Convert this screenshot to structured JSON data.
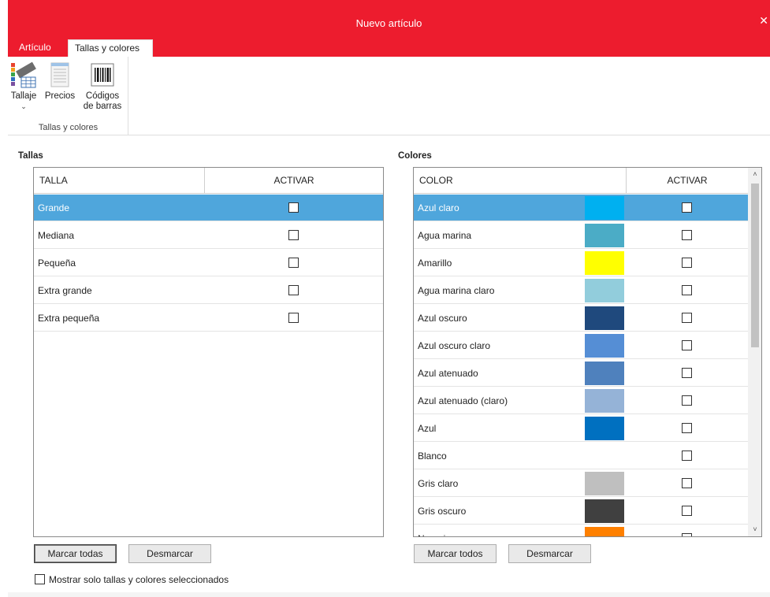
{
  "window": {
    "title": "Nuevo artículo",
    "close_glyph": "✕"
  },
  "tabs": [
    {
      "label": "Artículo",
      "active": false
    },
    {
      "label": "Tallas y colores",
      "active": true
    }
  ],
  "ribbon": {
    "group_label": "Tallas y colores",
    "buttons": [
      {
        "label": "Tallaje",
        "icon": "size-chart-icon",
        "has_dropdown": true,
        "caret": "⌄"
      },
      {
        "label": "Precios",
        "icon": "price-sheet-icon"
      },
      {
        "label_line1": "Códigos",
        "label_line2": "de barras",
        "icon": "barcode-icon"
      }
    ]
  },
  "tallas": {
    "section_label": "Tallas",
    "columns": [
      "TALLA",
      "ACTIVAR"
    ],
    "rows": [
      {
        "name": "Grande",
        "checked": false,
        "selected": true
      },
      {
        "name": "Mediana",
        "checked": false
      },
      {
        "name": "Pequeña",
        "checked": false
      },
      {
        "name": "Extra grande",
        "checked": false
      },
      {
        "name": "Extra pequeña",
        "checked": false
      }
    ],
    "mark_all_label": "Marcar todas",
    "unmark_label": "Desmarcar"
  },
  "colores": {
    "section_label": "Colores",
    "columns": [
      "COLOR",
      "ACTIVAR"
    ],
    "rows": [
      {
        "name": "Azul claro",
        "swatch": "#00b0f0",
        "checked": false,
        "selected": true
      },
      {
        "name": "Agua marina",
        "swatch": "#4bacc6",
        "checked": false
      },
      {
        "name": "Amarillo",
        "swatch": "#ffff00",
        "checked": false
      },
      {
        "name": "Agua marina claro",
        "swatch": "#92cddc",
        "checked": false
      },
      {
        "name": "Azul oscuro",
        "swatch": "#1f497d",
        "checked": false
      },
      {
        "name": "Azul oscuro claro",
        "swatch": "#558ed5",
        "checked": false
      },
      {
        "name": "Azul atenuado",
        "swatch": "#4f81bd",
        "checked": false
      },
      {
        "name": "Azul atenuado (claro)",
        "swatch": "#95b3d7",
        "checked": false
      },
      {
        "name": "Azul",
        "swatch": "#0070c0",
        "checked": false
      },
      {
        "name": "Blanco",
        "swatch": "#ffffff",
        "checked": false
      },
      {
        "name": "Gris claro",
        "swatch": "#bfbfbf",
        "checked": false
      },
      {
        "name": "Gris oscuro",
        "swatch": "#404040",
        "checked": false
      },
      {
        "name": "Naranja",
        "swatch": "#ff8000",
        "checked": false
      }
    ],
    "mark_all_label": "Marcar todos",
    "unmark_label": "Desmarcar",
    "scroll_up": "˄",
    "scroll_down": "˅"
  },
  "footer": {
    "show_selected_label": "Mostrar solo tallas y colores seleccionados",
    "checked": false
  },
  "colors": {
    "accent": "#ed1c2e",
    "selection": "#4fa6dc"
  }
}
